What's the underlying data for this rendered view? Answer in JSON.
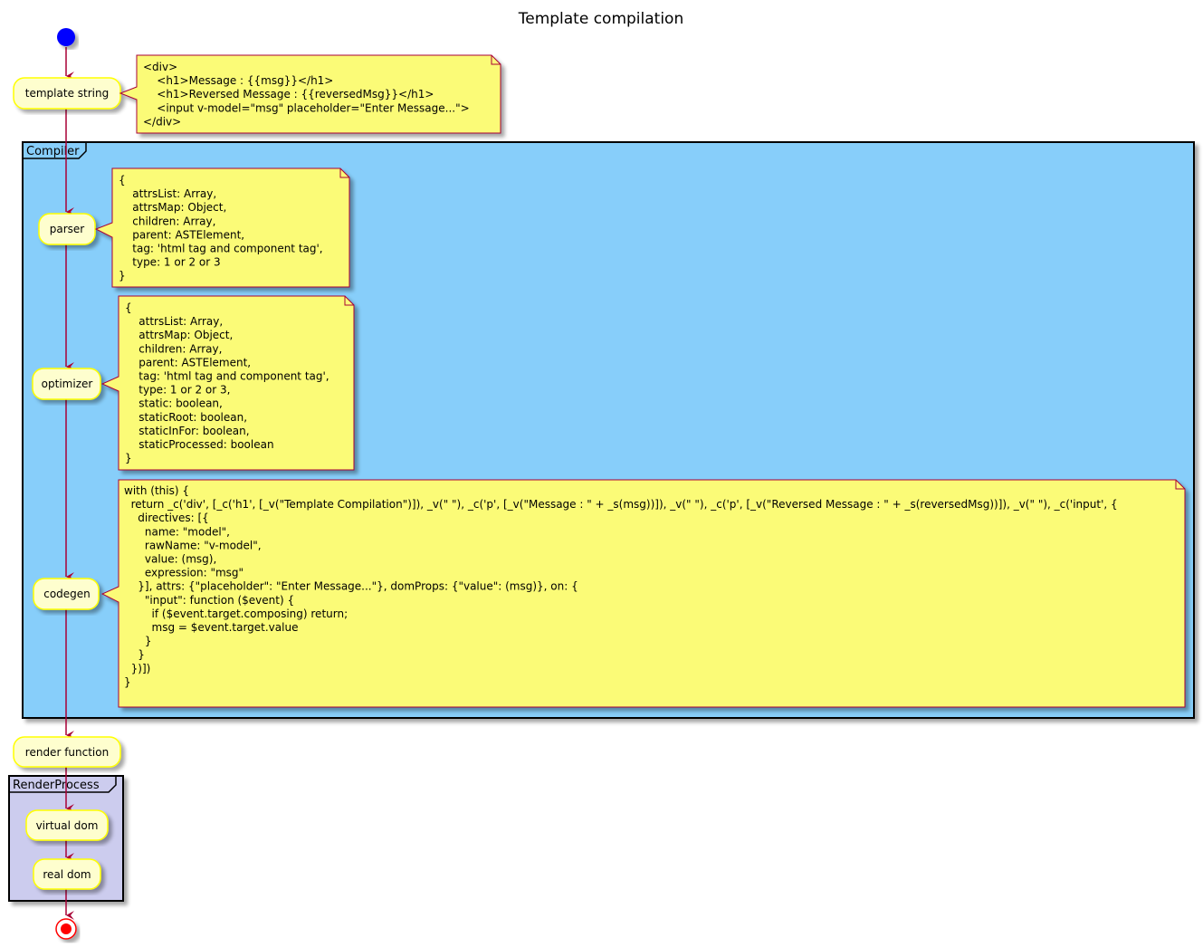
{
  "title": "Template compilation",
  "colors": {
    "start": "#0000ff",
    "end": "#ff0000",
    "arrow": "#a80036",
    "node_fill": "#fefece",
    "node_border": "#ffff00",
    "note_fill": "#fbfb77",
    "note_border": "#a80036",
    "compiler_fill": "#87cefa",
    "render_fill": "#ccccee",
    "frame_border": "#000000"
  },
  "nodes": {
    "template_string": "template string",
    "parser": "parser",
    "optimizer": "optimizer",
    "codegen": "codegen",
    "render_function": "render function",
    "virtual_dom": "virtual dom",
    "real_dom": "real dom"
  },
  "frames": {
    "compiler": "Compiler",
    "render_process": "RenderProcess"
  },
  "notes": {
    "template_string": [
      "<div>",
      "    <h1>Message : {{msg}}</h1>",
      "    <h1>Reversed Message : {{reversedMsg}}</h1>",
      "    <input v-model=\"msg\" placeholder=\"Enter Message...\">",
      "</div>"
    ],
    "parser": [
      "{",
      "    attrsList: Array,",
      "    attrsMap: Object,",
      "    children: Array,",
      "    parent: ASTElement,",
      "    tag: 'html tag and component tag',",
      "    type: 1 or 2 or 3",
      "}"
    ],
    "optimizer": [
      "{",
      "    attrsList: Array,",
      "    attrsMap: Object,",
      "    children: Array,",
      "    parent: ASTElement,",
      "    tag: 'html tag and component tag',",
      "    type: 1 or 2 or 3,",
      "    static: boolean,",
      "    staticRoot: boolean,",
      "    staticInFor: boolean,",
      "    staticProcessed: boolean",
      "}"
    ],
    "codegen": [
      "with (this) {",
      "  return _c('div', [_c('h1', [_v(\"Template Compilation\")]), _v(\" \"), _c('p', [_v(\"Message : \" + _s(msg))]), _v(\" \"), _c('p', [_v(\"Reversed Message : \" + _s(reversedMsg))]), _v(\" \"), _c('input', {",
      "    directives: [{",
      "      name: \"model\",",
      "      rawName: \"v-model\",",
      "      value: (msg),",
      "      expression: \"msg\"",
      "    }], attrs: {\"placeholder\": \"Enter Message...\"}, domProps: {\"value\": (msg)}, on: {",
      "      \"input\": function ($event) {",
      "        if ($event.target.composing) return;",
      "        msg = $event.target.value",
      "      }",
      "    }",
      "  })])",
      "}",
      ""
    ]
  }
}
